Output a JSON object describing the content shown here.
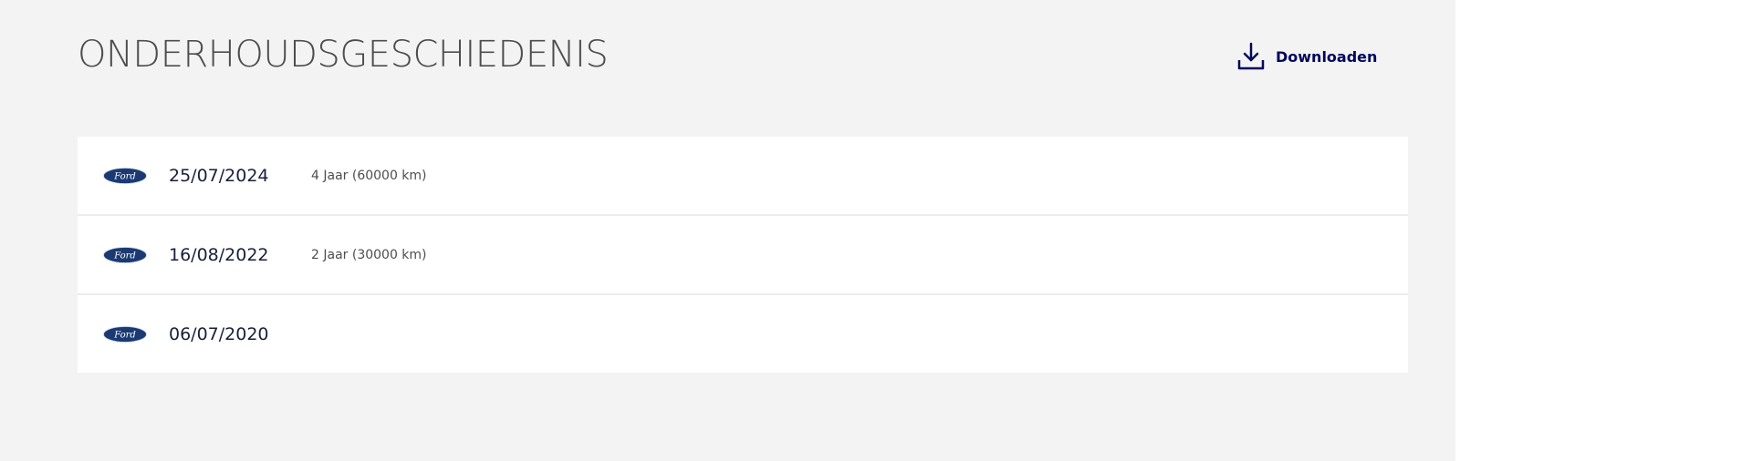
{
  "header": {
    "title": "ONDERHOUDSGESCHIEDENIS",
    "download_label": "Downloaden",
    "download_icon": "download-icon"
  },
  "brand": {
    "logo_text": "Ford",
    "logo_color": "#1b3a73"
  },
  "history": [
    {
      "date": "25/07/2024",
      "interval": "4 Jaar (60000 km)"
    },
    {
      "date": "16/08/2022",
      "interval": "2 Jaar (30000 km)"
    },
    {
      "date": "06/07/2020",
      "interval": ""
    }
  ],
  "colors": {
    "panel_bg": "#f3f3f3",
    "accent": "#00095b",
    "title": "#4d4d4d"
  }
}
